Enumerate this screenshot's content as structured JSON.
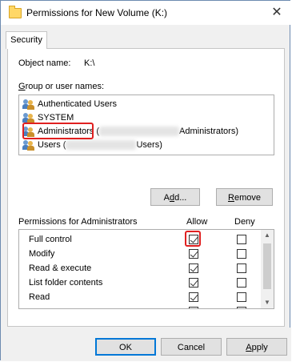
{
  "window": {
    "title": "Permissions for New Volume (K:)",
    "close_glyph": "✕"
  },
  "tabs": [
    {
      "label": "Security"
    }
  ],
  "object": {
    "label": "Object name:",
    "value": "K:\\"
  },
  "groups": {
    "label": "Group or user names:",
    "items": [
      {
        "label": "Authenticated Users",
        "icon": "users-group-icon"
      },
      {
        "label": "SYSTEM",
        "icon": "users-group-icon"
      },
      {
        "label": "Administrators",
        "suffix_open": "(",
        "suffix_tail": "Administrators)",
        "icon": "users-group-icon",
        "selected": true
      },
      {
        "label": "Users",
        "suffix_open": "(",
        "suffix_tail": "Users)",
        "icon": "users-group-icon"
      }
    ]
  },
  "buttons": {
    "add": "Add...",
    "remove": "Remove",
    "ok": "OK",
    "cancel": "Cancel",
    "apply": "Apply"
  },
  "permissions": {
    "title": "Permissions for Administrators",
    "allow_header": "Allow",
    "deny_header": "Deny",
    "rows": [
      {
        "name": "Full control",
        "allow": true,
        "deny": false
      },
      {
        "name": "Modify",
        "allow": true,
        "deny": false
      },
      {
        "name": "Read & execute",
        "allow": true,
        "deny": false
      },
      {
        "name": "List folder contents",
        "allow": true,
        "deny": false
      },
      {
        "name": "Read",
        "allow": true,
        "deny": false
      }
    ]
  },
  "colors": {
    "highlight": "#e02020",
    "default_button_border": "#0078d7"
  }
}
